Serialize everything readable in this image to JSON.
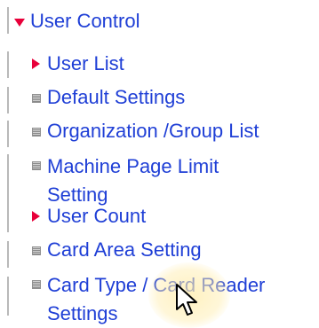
{
  "top_clip_text": "...",
  "tree": {
    "root": {
      "label": "User Control",
      "expanded": true,
      "icon": "caret-down-icon"
    },
    "items": [
      {
        "label": "User List",
        "icon": "caret-right-icon",
        "type": "expandable"
      },
      {
        "label": "Default Settings",
        "icon": "page-icon",
        "type": "leaf"
      },
      {
        "label": "Organization /Group List",
        "icon": "page-icon",
        "type": "leaf"
      },
      {
        "label": "Machine Page Limit Setting",
        "icon": "page-icon",
        "type": "leaf"
      },
      {
        "label": "User Count",
        "icon": "caret-right-icon",
        "type": "expandable"
      },
      {
        "label": "Card Area Setting",
        "icon": "page-icon",
        "type": "leaf"
      },
      {
        "label": "Card Type / Card Reader Settings",
        "icon": "page-icon",
        "type": "leaf"
      }
    ]
  },
  "colors": {
    "link": "#1f3fd6",
    "caret": "#e8003a",
    "tree_line": "#b9b9b9",
    "highlight": "#ffeca8"
  }
}
